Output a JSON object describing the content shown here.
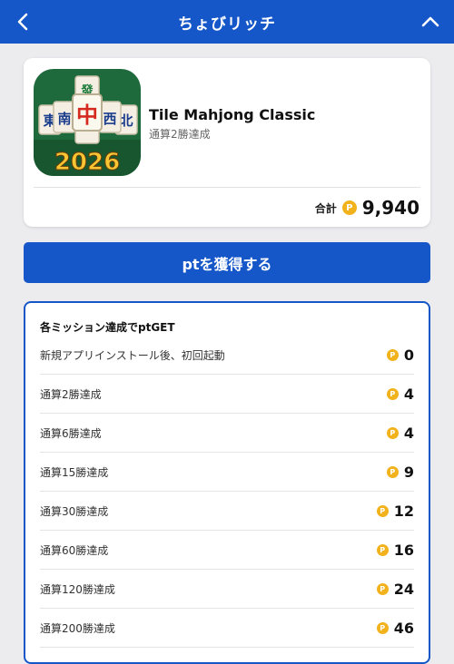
{
  "header": {
    "title": "ちょびリッチ"
  },
  "app": {
    "name": "Tile Mahjong Classic",
    "subtitle": "通算2勝達成",
    "icon_year": "2026",
    "total_label": "合計",
    "total_value": "9,940",
    "coin_symbol": "P"
  },
  "action": {
    "get_button_label": "ptを獲得する"
  },
  "missions": {
    "title": "各ミッション達成でptGET",
    "items": [
      {
        "label": "新規アプリインストール後、初回起動",
        "points": "0"
      },
      {
        "label": "通算2勝達成",
        "points": "4"
      },
      {
        "label": "通算6勝達成",
        "points": "4"
      },
      {
        "label": "通算15勝達成",
        "points": "9"
      },
      {
        "label": "通算30勝達成",
        "points": "12"
      },
      {
        "label": "通算60勝達成",
        "points": "16"
      },
      {
        "label": "通算120勝達成",
        "points": "24"
      },
      {
        "label": "通算200勝達成",
        "points": "46"
      }
    ]
  },
  "colors": {
    "brand_blue": "#1556c8",
    "coin_gold": "#f2b21b",
    "page_bg": "#ececef"
  }
}
